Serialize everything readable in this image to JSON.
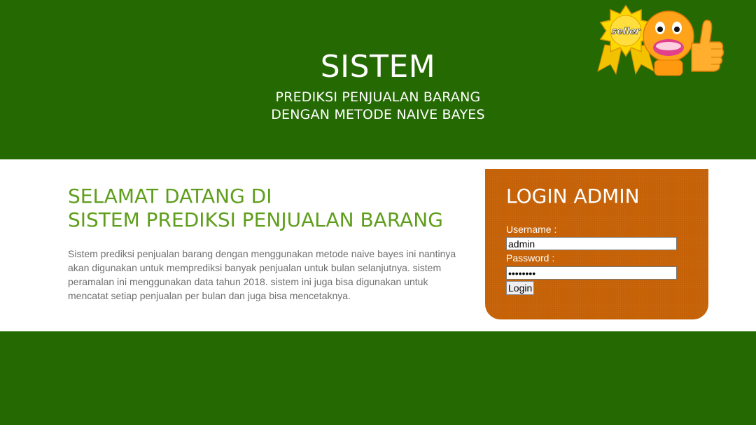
{
  "header": {
    "title": "SISTEM",
    "subtitle_line1": "PREDIKSI PENJUALAN BARANG",
    "subtitle_line2": "DENGAN METODE NAIVE BAYES",
    "badge_text": "seller"
  },
  "welcome": {
    "line1": "SELAMAT DATANG DI",
    "line2": "SISTEM PREDIKSI PENJUALAN BARANG",
    "description": "Sistem prediksi penjualan barang dengan menggunakan metode naive bayes ini nantinya akan digunakan untuk memprediksi banyak penjualan untuk bulan selanjutnya. sistem peramalan ini menggunakan data tahun 2018. sistem ini juga bisa digunakan untuk mencatat setiap penjualan per bulan dan juga bisa mencetaknya."
  },
  "login": {
    "title": "LOGIN ADMIN",
    "username_label": "Username :",
    "username_value": "admin",
    "password_label": "Password :",
    "password_value": "••••••••",
    "button_label": "Login"
  },
  "colors": {
    "header_bg": "#256903",
    "login_bg": "#c56004",
    "welcome_text": "#5f9e1c"
  },
  "icons": {
    "mascot": "thumbs-up-seller-badge-icon"
  }
}
